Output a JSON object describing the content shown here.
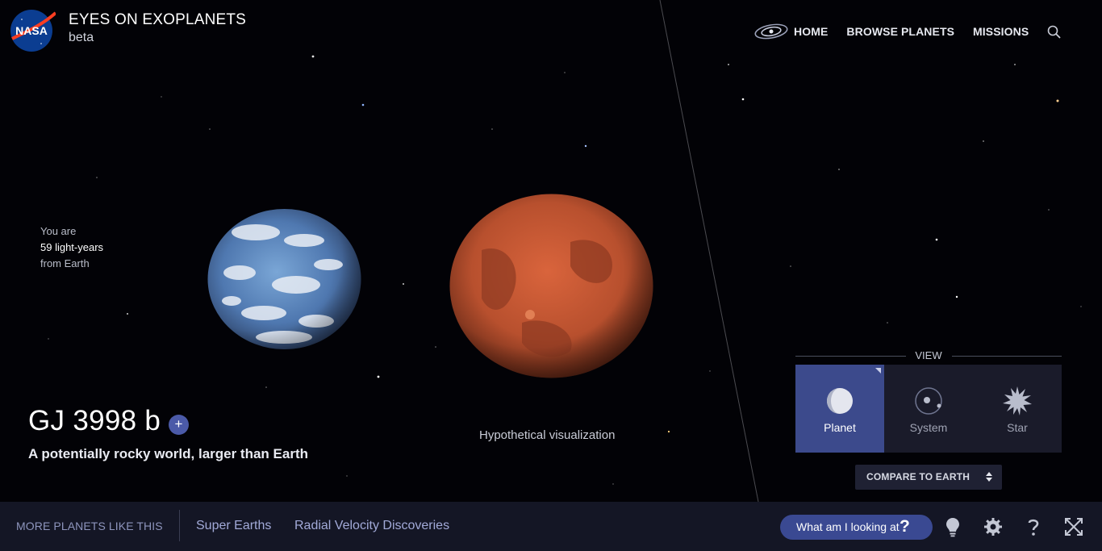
{
  "header": {
    "title": "EYES ON EXOPLANETS",
    "subtitle": "beta",
    "logo_text": "NASA",
    "nav": [
      {
        "label": "HOME",
        "icon": "galaxy-icon"
      },
      {
        "label": "BROWSE PLANETS"
      },
      {
        "label": "MISSIONS"
      }
    ],
    "search_icon": "search-icon"
  },
  "location": {
    "line1": "You are",
    "distance": "59 light-years",
    "line3": "from Earth"
  },
  "planet": {
    "name": "GJ 3998 b",
    "add_symbol": "+",
    "description": "A potentially rocky world, larger than Earth",
    "visualization_note": "Hypothetical visualization"
  },
  "view": {
    "label": "VIEW",
    "options": [
      {
        "label": "Planet",
        "icon": "planet-icon",
        "active": true
      },
      {
        "label": "System",
        "icon": "system-icon",
        "active": false
      },
      {
        "label": "Star",
        "icon": "star-icon",
        "active": false
      }
    ],
    "compare_label": "COMPARE TO EARTH"
  },
  "bottom_bar": {
    "more_label": "MORE PLANETS LIKE THIS",
    "links": [
      "Super Earths",
      "Radial Velocity Discoveries"
    ],
    "help_label": "What am I looking at",
    "help_symbol": "?",
    "icons": [
      "lightbulb-icon",
      "settings-icon",
      "help-icon",
      "fullscreen-icon"
    ]
  },
  "colors": {
    "background": "#020206",
    "accent": "#3c4a8c",
    "bottom_bar": "#141625",
    "link": "#a2aad8"
  }
}
